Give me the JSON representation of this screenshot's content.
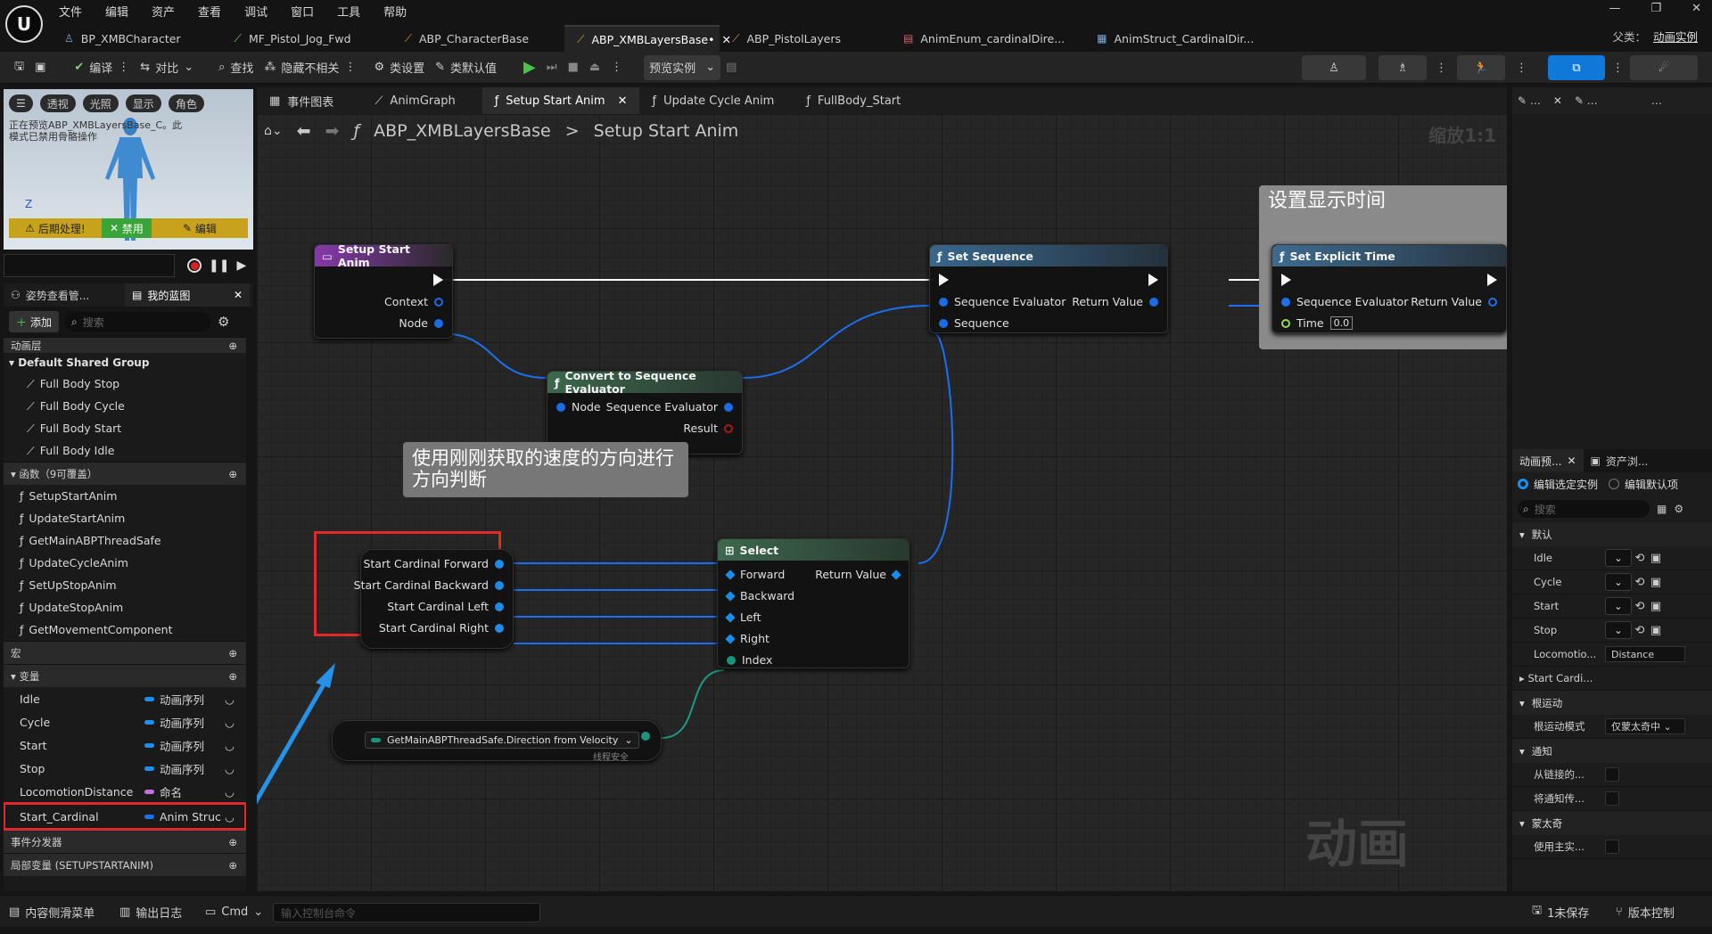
{
  "app": {
    "logo": "U"
  },
  "menu": [
    "文件",
    "编辑",
    "资产",
    "查看",
    "调试",
    "窗口",
    "工具",
    "帮助"
  ],
  "window_controls": [
    "—",
    "❐",
    "✕"
  ],
  "doc_tabs": [
    {
      "label": "BP_XMBCharacter",
      "icon": "person-icon"
    },
    {
      "label": "MF_Pistol_Jog_Fwd",
      "icon": "anim-icon"
    },
    {
      "label": "ABP_CharacterBase",
      "icon": "anim-bp-icon"
    },
    {
      "label": "ABP_XMBLayersBase•",
      "icon": "anim-bp-icon",
      "close": "✕"
    },
    {
      "label": "ABP_PistolLayers",
      "icon": "anim-bp-icon"
    },
    {
      "label": "AnimEnum_cardinalDire...",
      "icon": "enum-icon"
    },
    {
      "label": "AnimStruct_CardinalDir...",
      "icon": "struct-icon"
    }
  ],
  "parent_class": {
    "label": "父类：",
    "value": "动画实例"
  },
  "toolbar": {
    "compile": "编译",
    "diff": "对比",
    "find": "查找",
    "hide": "隐藏不相关",
    "class_settings": "类设置",
    "class_defaults": "类默认值",
    "preview_instance": "预览实例"
  },
  "viewport": {
    "buttons": [
      "透视",
      "光照",
      "显示",
      "角色"
    ],
    "note": "正在预览ABP_XMBLayersBase_C。此模式已禁用骨骼操作",
    "bar": [
      "后期处理!",
      "禁用",
      "编辑"
    ],
    "axis": "Z"
  },
  "bp_tabs": {
    "pose": "姿势查看管...",
    "my_bp": "我的蓝图",
    "close": "✕"
  },
  "add": {
    "label": "添加",
    "search_placeholder": "搜索"
  },
  "tree": {
    "anim_layers": "动画层",
    "default_group": "Default Shared Group",
    "layers": [
      "Full Body Stop",
      "Full Body Cycle",
      "Full Body Start",
      "Full Body Idle"
    ],
    "functions_header": "函数（9可覆盖）",
    "functions": [
      "SetupStartAnim",
      "UpdateStartAnim",
      "GetMainABPThreadSafe",
      "UpdateCycleAnim",
      "SetUpStopAnim",
      "UpdateStopAnim",
      "GetMovementComponent"
    ],
    "macros": "宏",
    "variables_header": "变量",
    "variables": [
      {
        "name": "Idle",
        "type": "动画序列",
        "color": "#1c8ff0"
      },
      {
        "name": "Cycle",
        "type": "动画序列",
        "color": "#1c8ff0"
      },
      {
        "name": "Start",
        "type": "动画序列",
        "color": "#1c8ff0"
      },
      {
        "name": "Stop",
        "type": "动画序列",
        "color": "#1c8ff0"
      },
      {
        "name": "LocomotionDistance",
        "type": "命名",
        "color": "#c070e0"
      },
      {
        "name": "Start_Cardinal",
        "type": "Anim Struc",
        "color": "#1c6ff0"
      }
    ],
    "dispatchers": "事件分发器",
    "locals": "局部变量 (SETUPSTARTANIM)"
  },
  "graph_tabs": [
    {
      "label": "事件图表",
      "icon": "grid-icon"
    },
    {
      "label": "AnimGraph",
      "icon": "anim-graph-icon"
    },
    {
      "label": "Setup Start Anim",
      "icon": "function-icon",
      "close": "✕"
    },
    {
      "label": "Update Cycle Anim",
      "icon": "function-icon"
    },
    {
      "label": "FullBody_Start",
      "icon": "function-icon"
    }
  ],
  "breadcrumb": {
    "root": "ABP_XMBLayersBase",
    "sep": ">",
    "leaf": "Setup Start Anim"
  },
  "zoom": "缩放1:1",
  "watermark": "动画",
  "nodes": {
    "setup": {
      "title": "Setup Start Anim",
      "pins": [
        "Context",
        "Node"
      ]
    },
    "convert": {
      "title": "Convert to Sequence Evaluator",
      "in": "Node",
      "out": "Sequence Evaluator",
      "result": "Result"
    },
    "set_seq": {
      "title": "Set Sequence",
      "in1": "Sequence Evaluator",
      "in2": "Sequence",
      "out": "Return Value"
    },
    "set_time": {
      "title": "Set Explicit Time",
      "in1": "Sequence Evaluator",
      "in2": "Time",
      "time_value": "0.0",
      "out": "Return Value"
    },
    "vars": [
      "Start Cardinal Forward",
      "Start Cardinal Backward",
      "Start Cardinal Left",
      "Start Cardinal Right"
    ],
    "select": {
      "title": "Select",
      "pins": [
        "Forward",
        "Backward",
        "Left",
        "Right",
        "Index"
      ],
      "out": "Return Value"
    },
    "getter": {
      "label": "GetMainABPThreadSafe.Direction from Velocity",
      "badge": "线程安全"
    }
  },
  "comments": {
    "display_time": "设置显示时间",
    "direction": "使用刚刚获取的速度的方向进行方向判断"
  },
  "right": {
    "preview_tab": "动画预...",
    "assets_tab": "资产浏...",
    "radio1": "编辑选定实例",
    "radio2": "编辑默认项",
    "search": "搜索",
    "default": "默认",
    "rows": [
      "Idle",
      "Cycle",
      "Start",
      "Stop"
    ],
    "loco_label": "Locomotio...",
    "loco_value": "Distance",
    "start_cardi": "Start Cardi...",
    "root_motion": "根运动",
    "root_mode_label": "根运动模式",
    "root_mode_value": "仅蒙太奇中",
    "notify": "通知",
    "notify1": "从链接的...",
    "notify2": "将通知传...",
    "montage": "蒙太奇",
    "montage1": "使用主实..."
  },
  "status": {
    "content": "内容侧滑菜单",
    "log": "输出日志",
    "cmd": "Cmd",
    "console_placeholder": "输入控制台命令",
    "unsaved": "1未保存",
    "source": "版本控制"
  }
}
